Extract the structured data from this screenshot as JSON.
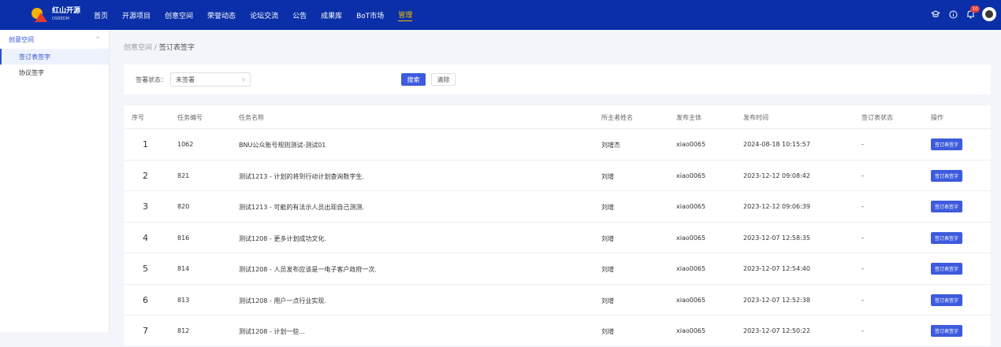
{
  "app": {
    "logo_cn": "红山开源",
    "logo_en": "OSREDM"
  },
  "nav": [
    {
      "label": "首页",
      "active": false
    },
    {
      "label": "开源项目",
      "active": false
    },
    {
      "label": "创意空间",
      "active": false
    },
    {
      "label": "荣誉动态",
      "active": false
    },
    {
      "label": "论坛交流",
      "active": false
    },
    {
      "label": "公告",
      "active": false
    },
    {
      "label": "成果库",
      "active": false
    },
    {
      "label": "BoT市场",
      "active": false
    },
    {
      "label": "管理",
      "active": true
    }
  ],
  "topbar": {
    "notification_count": "10"
  },
  "sidebar": {
    "group_label": "创意空间",
    "items": [
      {
        "label": "签订表签字",
        "active": true
      },
      {
        "label": "协议签字",
        "active": false
      }
    ]
  },
  "breadcrumb": {
    "parent": "创意空间",
    "sep": "/",
    "current": "签订表签字"
  },
  "filter": {
    "status_label": "签署状态：",
    "status_value": "未签署",
    "search_label": "搜索",
    "clear_label": "清除"
  },
  "table": {
    "columns": [
      "序号",
      "任务编号",
      "任务名称",
      "所主者姓名",
      "发布主体",
      "发布时间",
      "签订表状态",
      "操作"
    ],
    "rows": [
      {
        "no": "1",
        "id": "1062",
        "name": "BNU公众账号规则测试-测试01",
        "owner": "刘增杰",
        "publisher": "xiao0065",
        "time": "2024-08-18 10:15:57",
        "status": "-",
        "action": "签订表签字"
      },
      {
        "no": "2",
        "id": "821",
        "name": "测试1213 - 计划的将到行动计划查询数字生.",
        "owner": "刘增",
        "publisher": "xiao0065",
        "time": "2023-12-12 09:08:42",
        "status": "-",
        "action": "签订表签字"
      },
      {
        "no": "3",
        "id": "820",
        "name": "测试1213 - 可能的有法示人员出现自己测测.",
        "owner": "刘增",
        "publisher": "xiao0065",
        "time": "2023-12-12 09:06:39",
        "status": "-",
        "action": "签订表签字"
      },
      {
        "no": "4",
        "id": "816",
        "name": "测试1208 - 更多计划成功文化.",
        "owner": "刘增",
        "publisher": "xiao0065",
        "time": "2023-12-07 12:58:35",
        "status": "-",
        "action": "签订表签字"
      },
      {
        "no": "5",
        "id": "814",
        "name": "测试1208 - 人员发布应该是一电子客户政府一次.",
        "owner": "刘增",
        "publisher": "xiao0065",
        "time": "2023-12-07 12:54:40",
        "status": "-",
        "action": "签订表签字"
      },
      {
        "no": "6",
        "id": "813",
        "name": "测试1208 - 用户一点行业实现.",
        "owner": "刘增",
        "publisher": "xiao0065",
        "time": "2023-12-07 12:52:38",
        "status": "-",
        "action": "签订表签字"
      },
      {
        "no": "7",
        "id": "812",
        "name": "测试1208 - 计划一些...",
        "owner": "刘增",
        "publisher": "xiao0065",
        "time": "2023-12-07 12:50:22",
        "status": "-",
        "action": "签订表签字"
      }
    ]
  }
}
